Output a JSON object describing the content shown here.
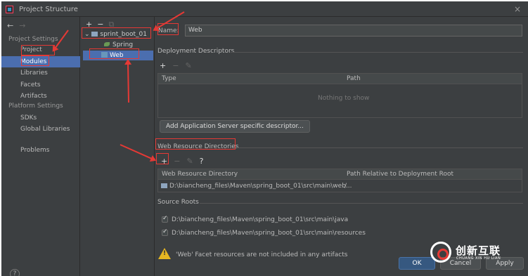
{
  "window": {
    "title": "Project Structure",
    "close_icon": "×"
  },
  "nav": {
    "back": "←",
    "forward": "→",
    "project_settings_header": "Project Settings",
    "items": [
      "Project",
      "Modules",
      "Libraries",
      "Facets",
      "Artifacts"
    ],
    "platform_settings_header": "Platform Settings",
    "platform_items": [
      "SDKs",
      "Global Libraries"
    ],
    "problems": "Problems",
    "help": "?"
  },
  "tree": {
    "add": "+",
    "remove": "−",
    "copy": "⧉",
    "module": "sprint_boot_01",
    "spring": "Spring",
    "web": "Web"
  },
  "main": {
    "name_label": "Name:",
    "name_value": "Web",
    "deployment": {
      "title": "Deployment Descriptors",
      "add": "+",
      "remove": "−",
      "edit": "✎",
      "columns": [
        "Type",
        "Path"
      ],
      "empty": "Nothing to show",
      "button": "Add Application Server specific descriptor..."
    },
    "web_resources": {
      "title": "Web Resource Directories",
      "add": "+",
      "remove": "−",
      "edit": "✎",
      "help": "?",
      "columns": [
        "Web Resource Directory",
        "Path Relative to Deployment Root"
      ],
      "rows": [
        {
          "dir": "D:\\biancheng_files\\Maven\\spring_boot_01\\src\\main\\web...",
          "path": "/"
        }
      ]
    },
    "source_roots": {
      "title": "Source Roots",
      "items": [
        "D:\\biancheng_files\\Maven\\spring_boot_01\\src\\main\\java",
        "D:\\biancheng_files\\Maven\\spring_boot_01\\src\\main\\resources"
      ]
    },
    "warning": "'Web' Facet resources are not included in any artifacts"
  },
  "footer": {
    "ok": "OK",
    "cancel": "Cancel",
    "apply": "Apply"
  },
  "watermark": {
    "text": "创新互联",
    "sub": "CHUANG XIN HU LIAN"
  },
  "colors": {
    "accent": "#4b6eaf",
    "annotation": "#e53935",
    "background": "#3c3f41"
  }
}
